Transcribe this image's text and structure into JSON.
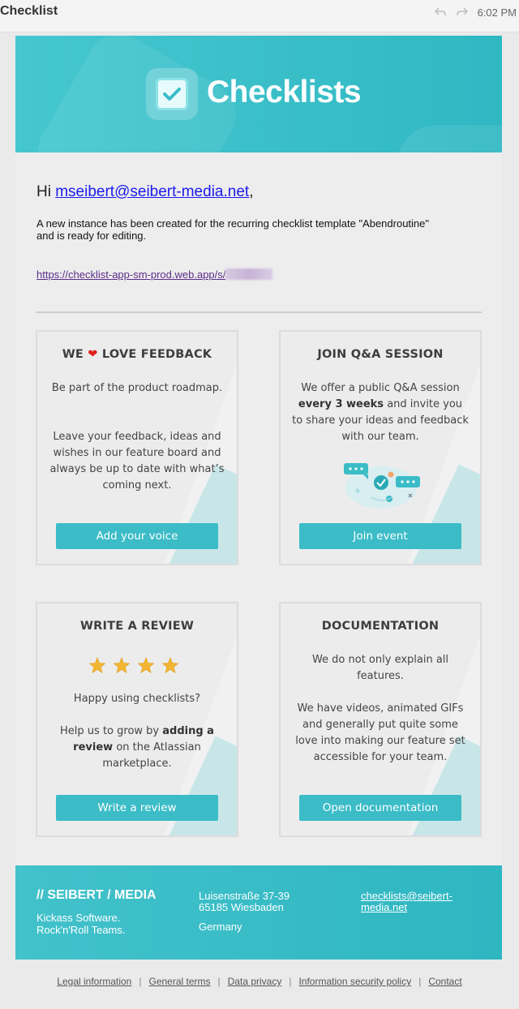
{
  "window": {
    "title": "Checklist",
    "time": "6:02 PM",
    "reply_icon": "reply-icon",
    "forward_icon": "forward-icon"
  },
  "banner": {
    "logo_text": "Checklists",
    "logo_icon": "checkbox-icon"
  },
  "greeting": {
    "prefix": "Hi ",
    "email": "mseibert@seibert-media.net",
    "suffix": ","
  },
  "message": "A new instance has been created for the recurring checklist template \"Abendroutine\"\n and is ready for editing.",
  "instance_link": "https://checklist-app-sm-prod.web.app/s/",
  "cards": {
    "feedback": {
      "title_pre": "WE",
      "title_post": "LOVE FEEDBACK",
      "p1": "Be part of the product roadmap.",
      "p2": "Leave your feedback, ideas and wishes in our feature board and always be up to date with what’s coming next.",
      "button": "Add your voice"
    },
    "qa": {
      "title": "JOIN Q&A SESSION",
      "p1a": "We offer a public Q&A session",
      "p1b": "every 3 weeks",
      "p1c": "and invite you to share your ideas and feedback with our team.",
      "button": "Join event"
    },
    "review": {
      "title": "WRITE A REVIEW",
      "stars": 4,
      "p1": "Happy using checklists?",
      "p2a": "Help us to grow by",
      "p2b": "adding a review",
      "p2c": "on the Atlassian marketplace.",
      "button": "Write a review"
    },
    "docs": {
      "title": "DOCUMENTATION",
      "p1": "We do not only explain all features.",
      "p2": "We have videos, animated GIFs and generally put quite some love into making our feature set accessible for your team.",
      "button": "Open documentation"
    }
  },
  "footer": {
    "brand": "// SEIBERT / MEDIA",
    "tagline": "Kickass Software.\nRock'n'Roll Teams.",
    "address": "Luisenstraße 37-39\n65185 Wiesbaden",
    "country": "Germany",
    "email": "checklists@seibert-media.net"
  },
  "legal": [
    "Legal information",
    "General terms",
    "Data privacy",
    "Information security policy",
    "Contact"
  ],
  "colors": {
    "accent": "#3bbcc7",
    "banner": "#3bbfc9",
    "heart": "#e0201e",
    "star": "#f2b632"
  }
}
